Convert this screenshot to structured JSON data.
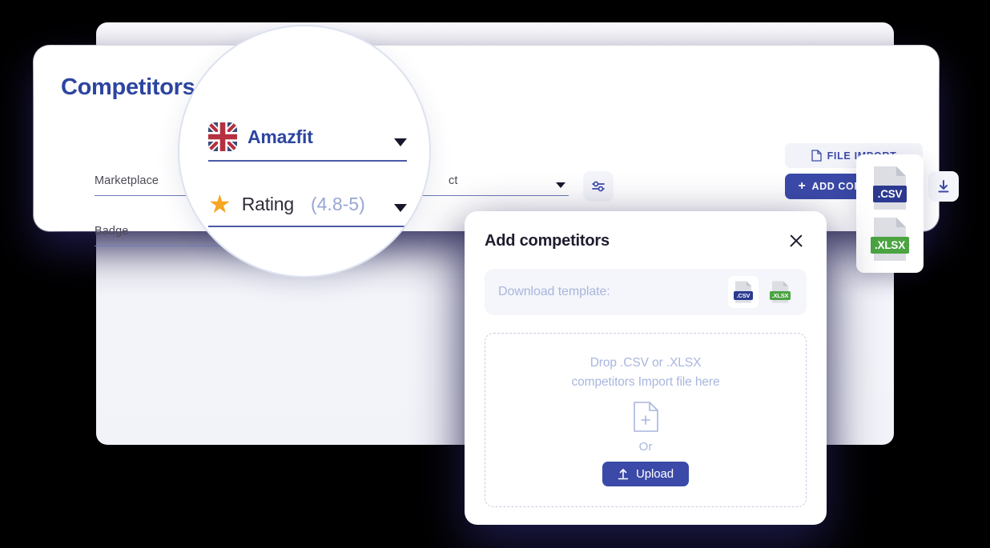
{
  "page": {
    "title": "Competitors"
  },
  "filters": {
    "marketplace": {
      "label": "Marketplace",
      "caret_icon": "chevron-down-icon"
    },
    "badge": {
      "label": "Badge",
      "caret_icon": "chevron-down-icon"
    },
    "product": {
      "label": "ct",
      "caret_icon": "chevron-down-icon"
    },
    "filter_icon": "sliders-icon"
  },
  "toolbar": {
    "file_import_label": "FILE IMPORT",
    "file_import_icon": "document-icon",
    "add_competitor_label": "ADD COMPETITOR",
    "add_competitor_plus": "+",
    "download_icon": "download-icon"
  },
  "format_dropdown": {
    "items": [
      {
        "label": ".CSV",
        "icon": "csv-file-icon",
        "color": "#2b3a8f"
      },
      {
        "label": ".XLSX",
        "icon": "xlsx-file-icon",
        "color": "#4ba341"
      }
    ]
  },
  "magnifier": {
    "rows": [
      {
        "icon": "uk-flag-icon",
        "label": "Amazfit",
        "sub": "",
        "caret_icon": "chevron-down-icon"
      },
      {
        "icon": "star-icon",
        "label": "Rating",
        "sub": "(4.8-5)",
        "caret_icon": "chevron-down-icon"
      }
    ]
  },
  "modal": {
    "title": "Add competitors",
    "close_icon": "close-icon",
    "template": {
      "label": "Download template:",
      "files": [
        {
          "label": ".CSV",
          "icon": "csv-file-icon",
          "color": "#2b3a8f"
        },
        {
          "label": ".XLSX",
          "icon": "xlsx-file-icon",
          "color": "#4ba341"
        }
      ]
    },
    "dropzone": {
      "line1": "Drop .CSV or .XLSX",
      "line2": "competitors Import file here",
      "icon": "file-plus-icon",
      "or_label": "Or",
      "upload_label": "Upload",
      "upload_icon": "upload-icon"
    }
  },
  "colors": {
    "brand_blue": "#3b4aa8",
    "title_blue": "#2d45a0",
    "muted_blue": "#a9b6dd",
    "csv_blue": "#2b3a8f",
    "xlsx_green": "#4ba341",
    "star_orange": "#f5a623",
    "shadow_navy": "#1f1b4d"
  }
}
